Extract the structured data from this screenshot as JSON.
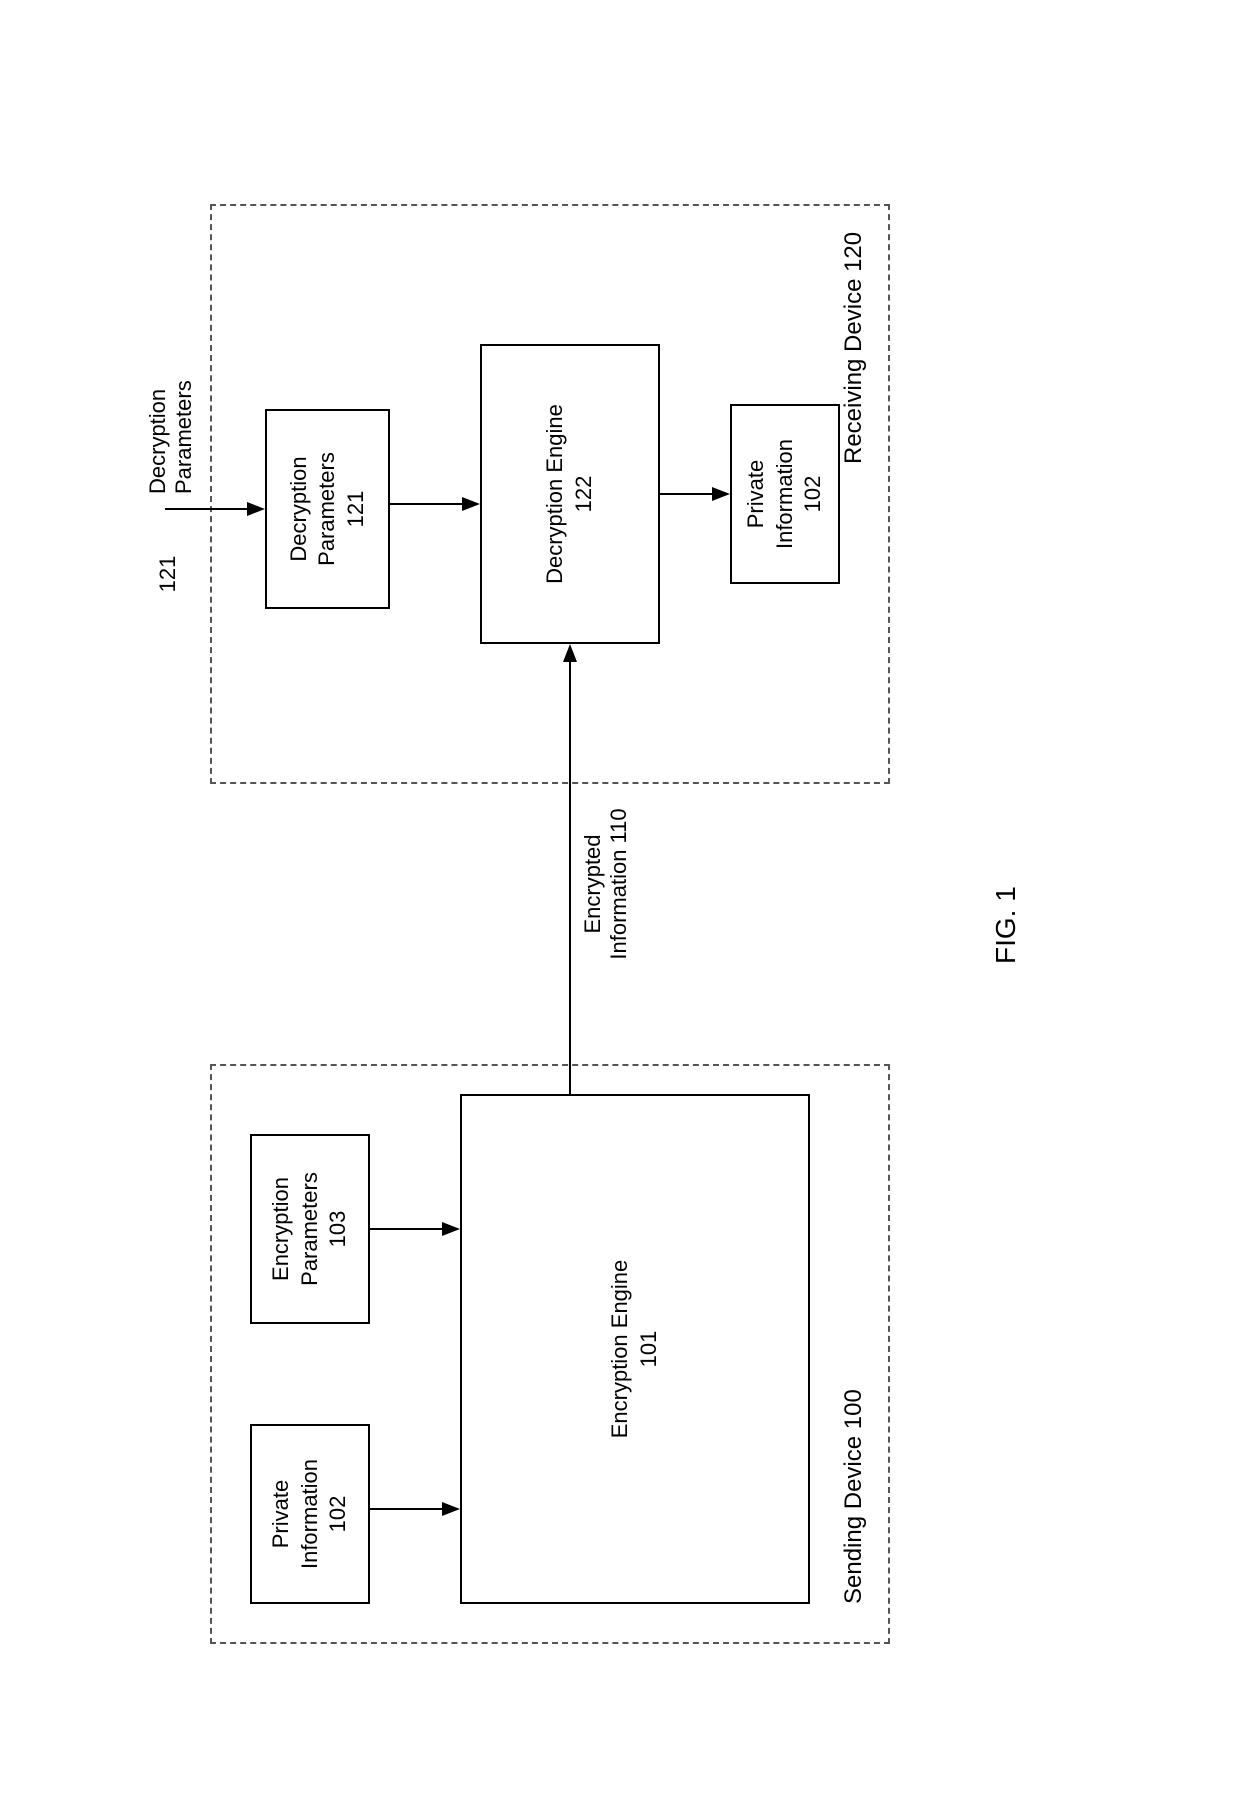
{
  "figure_label": "FIG. 1",
  "sending_device": {
    "label": "Sending Device 100",
    "private_info": {
      "line1": "Private",
      "line2": "Information",
      "line3": "102"
    },
    "encryption_params": {
      "line1": "Encryption",
      "line2": "Parameters",
      "line3": "103"
    },
    "encryption_engine": {
      "line1": "Encryption Engine",
      "line2": "101"
    }
  },
  "receiving_device": {
    "label": "Receiving Device 120",
    "decryption_params": {
      "line1": "Decryption",
      "line2": "Parameters",
      "line3": "121"
    },
    "decryption_engine": {
      "line1": "Decryption Engine",
      "line2": "122"
    },
    "private_info": {
      "line1": "Private",
      "line2": "Information",
      "line3": "102"
    }
  },
  "encrypted_info": {
    "line1": "Encrypted",
    "line2": "Information 110"
  },
  "external_decryption_params": {
    "number": "121",
    "label_line1": "Decryption",
    "label_line2": "Parameters"
  }
}
